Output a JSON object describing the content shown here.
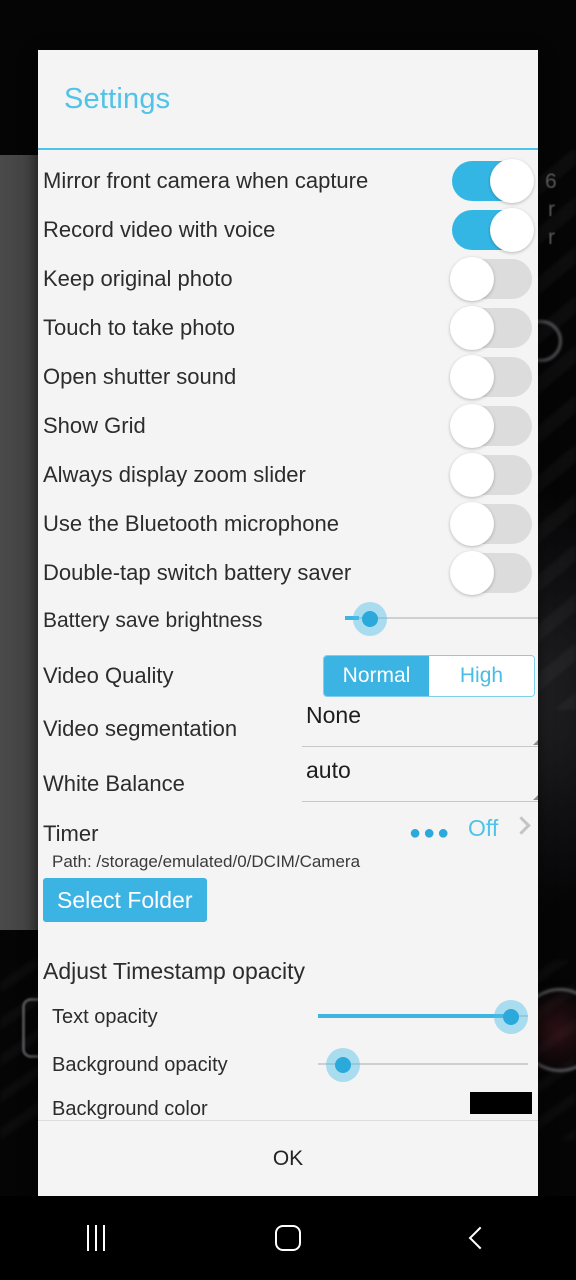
{
  "dialog": {
    "title": "Settings",
    "ok_label": "OK"
  },
  "toggles": [
    {
      "label": "Mirror front camera when capture",
      "state": "on"
    },
    {
      "label": "Record video with voice",
      "state": "on"
    },
    {
      "label": "Keep original photo",
      "state": "off"
    },
    {
      "label": "Touch to take photo",
      "state": "off"
    },
    {
      "label": "Open shutter sound",
      "state": "off"
    },
    {
      "label": "Show Grid",
      "state": "off"
    },
    {
      "label": "Always display zoom slider",
      "state": "off"
    },
    {
      "label": "Use the Bluetooth microphone",
      "state": "off"
    },
    {
      "label": "Double-tap switch battery saver",
      "state": "off"
    }
  ],
  "brightness": {
    "label": "Battery save brightness",
    "value_percent": 8
  },
  "video_quality": {
    "label": "Video Quality",
    "options": [
      "Normal",
      "High"
    ],
    "selected": "Normal"
  },
  "video_segmentation": {
    "label": "Video segmentation",
    "value": "None"
  },
  "white_balance": {
    "label": "White Balance",
    "value": "auto"
  },
  "timer": {
    "label": "Timer",
    "dots": "●●●",
    "value": "Off"
  },
  "storage": {
    "path_text": "Path: /storage/emulated/0/DCIM/Camera",
    "select_folder_label": "Select Folder"
  },
  "timestamp": {
    "section_title": "Adjust Timestamp opacity",
    "text_opacity": {
      "label": "Text opacity",
      "value_percent": 100
    },
    "background_opacity": {
      "label": "Background opacity",
      "value_percent": 0
    },
    "background_color": {
      "label": "Background color",
      "color": "#000000"
    }
  },
  "colors": {
    "accent": "#3bb3e3",
    "title": "#4fc3e8",
    "toggle_on": "#34b6e4",
    "toggle_off": "#dcdcdc",
    "dialog_bg": "#f4f4f4"
  },
  "navbar": {
    "recents": "recents",
    "home": "home",
    "back": "back"
  },
  "background": {
    "frag_1": "6",
    "frag_2": "r",
    "frag_3": "r"
  }
}
